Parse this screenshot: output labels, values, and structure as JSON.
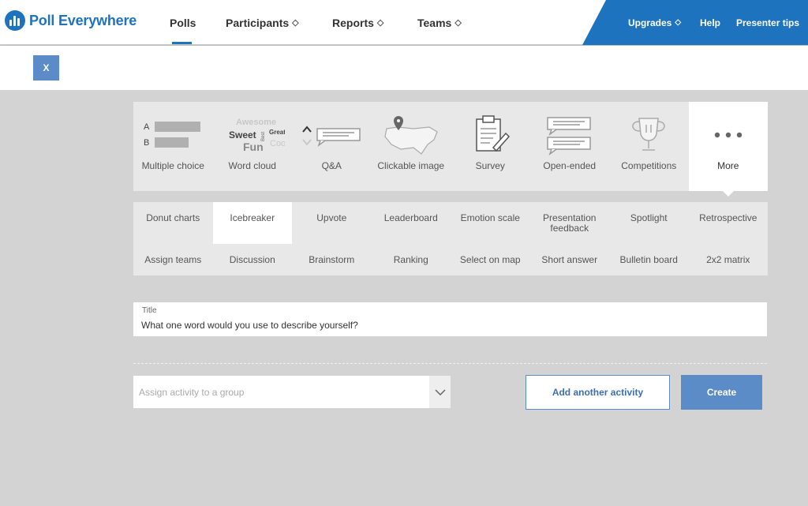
{
  "header": {
    "logo_text": "Poll Everywhere",
    "nav": [
      {
        "label": "Polls",
        "premium": false,
        "active": true
      },
      {
        "label": "Participants",
        "premium": true
      },
      {
        "label": "Reports",
        "premium": true
      },
      {
        "label": "Teams",
        "premium": true
      }
    ],
    "right_nav": [
      {
        "label": "Upgrades",
        "premium": true
      },
      {
        "label": "Help"
      },
      {
        "label": "Presenter tips"
      }
    ],
    "gem_glyph": "◇",
    "accent": "#1e73be"
  },
  "close_label": "X",
  "activity_types": [
    {
      "label": "Multiple choice",
      "icon": "multiple-choice-icon"
    },
    {
      "label": "Word cloud",
      "icon": "word-cloud-icon"
    },
    {
      "label": "Q&A",
      "icon": "qa-icon"
    },
    {
      "label": "Clickable image",
      "icon": "map-pin-icon"
    },
    {
      "label": "Survey",
      "icon": "clipboard-icon"
    },
    {
      "label": "Open-ended",
      "icon": "speech-bubbles-icon"
    },
    {
      "label": "Competitions",
      "icon": "trophy-icon"
    },
    {
      "label": "More",
      "icon": "more-icon",
      "active": true
    }
  ],
  "mc_icon_letters": {
    "a": "A",
    "b": "B"
  },
  "word_cloud_words": {
    "awesome": "Awesome",
    "sweet": "Sweet",
    "best": "Best",
    "great": "Great",
    "fun": "Fun",
    "cool": "Cool"
  },
  "sub_types_row1": [
    "Donut charts",
    "Icebreaker",
    "Upvote",
    "Leaderboard",
    "Emotion scale",
    "Presentation feedback",
    "Spotlight",
    "Retrospective"
  ],
  "sub_types_row2": [
    "Assign teams",
    "Discussion",
    "Brainstorm",
    "Ranking",
    "Select on map",
    "Short answer",
    "Bulletin board",
    "2x2 matrix"
  ],
  "selected_sub_type": "Icebreaker",
  "title_field": {
    "label": "Title",
    "value": "What one word would you use to describe yourself?"
  },
  "assign_select": {
    "placeholder": "Assign activity to a group"
  },
  "buttons": {
    "add_another": "Add another activity",
    "create": "Create"
  }
}
